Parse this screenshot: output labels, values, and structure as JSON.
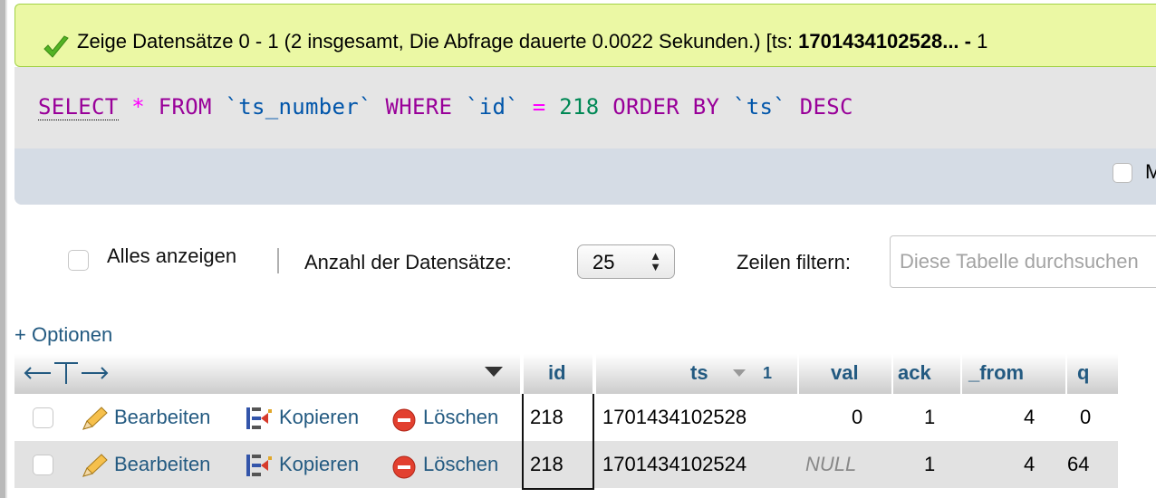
{
  "success": {
    "message": "Zeige Datensätze 0 - 1 (2 insgesamt, Die Abfrage dauerte 0.0022 Sekunden.) [ts: ",
    "bold_part": "1701434102528... - ",
    "overflow_char": "1"
  },
  "sql": {
    "select": "SELECT",
    "star": "*",
    "from": "FROM",
    "table": "`ts_number`",
    "where": "WHERE",
    "col": "`id`",
    "eq": "=",
    "value": "218",
    "order_by": "ORDER BY",
    "order_col": "`ts`",
    "desc": "DESC",
    "bar_checkbox_label": "M"
  },
  "nav": {
    "show_all_label": "Alles anzeigen",
    "rows_label": "Anzahl der Datensätze:",
    "rows_value": "25",
    "filter_label": "Zeilen filtern:",
    "filter_placeholder": "Diese Tabelle durchsuchen"
  },
  "options_link": "+ Optionen",
  "table": {
    "columns": [
      "id",
      "ts",
      "val",
      "ack",
      "_from",
      "q"
    ],
    "sort_index": "1",
    "rows": [
      {
        "edit": "Bearbeiten",
        "copy": "Kopieren",
        "delete": "Löschen",
        "id": "218",
        "ts": "1701434102528",
        "val": "0",
        "ack": "1",
        "from": "4",
        "q": "0"
      },
      {
        "edit": "Bearbeiten",
        "copy": "Kopieren",
        "delete": "Löschen",
        "id": "218",
        "ts": "1701434102524",
        "val": "NULL",
        "ack": "1",
        "from": "4",
        "q": "64"
      }
    ]
  },
  "colors": {
    "success_bg": "#ebf8a4",
    "link": "#235a81",
    "sql_keyword": "#990099"
  }
}
